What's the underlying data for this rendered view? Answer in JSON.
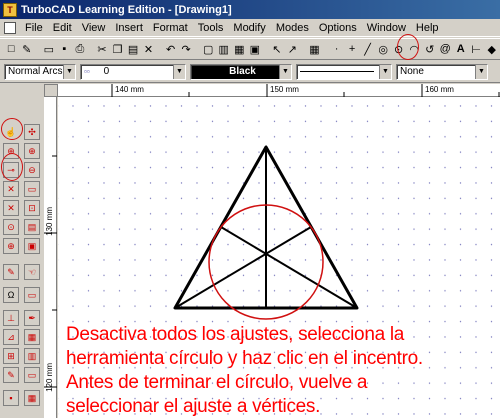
{
  "window": {
    "title": "TurboCAD Learning Edition - [Drawing1]",
    "app_icon": "turbocad-icon"
  },
  "menu": [
    "File",
    "Edit",
    "View",
    "Insert",
    "Format",
    "Tools",
    "Modify",
    "Modes",
    "Options",
    "Window",
    "Help"
  ],
  "toolbar2": {
    "arc_mode": "Normal Arcs",
    "layer_value": "0",
    "color": "Black",
    "line_style": "",
    "fill": "None"
  },
  "ruler": {
    "h_labels": [
      "140 mm",
      "150 mm",
      "160 mm"
    ],
    "v_labels": [
      "130 mm",
      "120 mm"
    ]
  },
  "instructions": [
    "Desactiva todos los ajustes, selecciona la",
    "herramienta círculo y haz clic en el incentro.",
    "Antes de terminar el círculo, vuelve a",
    "seleccionar el ajuste a vértices."
  ],
  "colors": {
    "annotation": "#ff0000",
    "title_bar": "#0a246a",
    "drawing_line": "#000000",
    "circle": "#d01010"
  }
}
